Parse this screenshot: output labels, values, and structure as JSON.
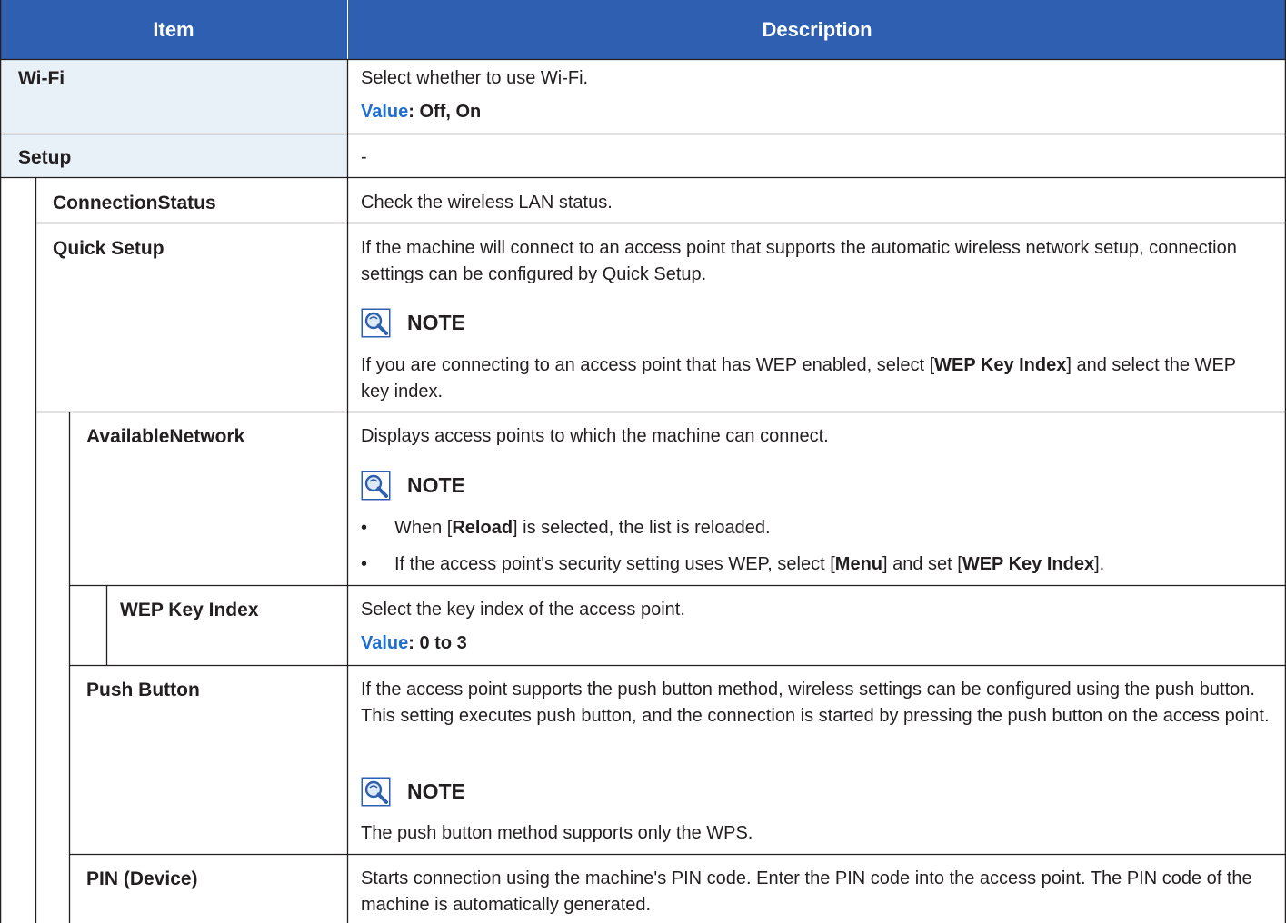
{
  "header": {
    "item": "Item",
    "description": "Description"
  },
  "rows": {
    "wifi": {
      "label": "Wi-Fi",
      "desc": "Select whether to use Wi-Fi.",
      "value_label": "Value",
      "value_text": ": Off, On"
    },
    "setup": {
      "label": "Setup",
      "desc": "-"
    },
    "connection_status": {
      "label": "ConnectionStatus",
      "desc": "Check the wireless LAN status."
    },
    "quick_setup": {
      "label": "Quick Setup",
      "desc": "If the machine will connect to an access point that supports the automatic wireless network setup, connection settings can be configured by Quick Setup.",
      "note_title": "NOTE",
      "note_pre": "If you are connecting to an access point that has WEP enabled, select [",
      "note_bold": "WEP Key Index",
      "note_post": "] and select the WEP key index."
    },
    "available_network": {
      "label": "AvailableNetwork",
      "desc": "Displays access points to which the machine can connect.",
      "note_title": "NOTE",
      "bullet_symbol": "•",
      "b1_pre": "When [",
      "b1_bold": "Reload",
      "b1_post": "] is selected, the list is reloaded.",
      "b2_pre": "If the access point's security setting uses WEP, select [",
      "b2_bold1": "Menu",
      "b2_mid": "] and set [",
      "b2_bold2": "WEP Key Index",
      "b2_post": "]."
    },
    "wep_key_index": {
      "label": "WEP Key Index",
      "desc": "Select the key index of the access point.",
      "value_label": "Value",
      "value_text": ": 0 to 3"
    },
    "push_button": {
      "label": "Push Button",
      "desc": "If the access point supports the push button method, wireless settings can be configured using the push button. This setting executes push button, and the connection is started by pressing the push button on the access point.",
      "note_title": "NOTE",
      "note_text": "The push button method supports only the WPS."
    },
    "pin_device": {
      "label": "PIN (Device)",
      "desc": "Starts connection using the machine's PIN code. Enter the PIN code into the access point. The PIN code of the machine is automatically generated."
    }
  },
  "colors": {
    "header_bg": "#2f5fb1",
    "item_shade": "#e8f0f8",
    "value_label": "#1f6ed6",
    "border": "#231f20"
  },
  "icons": {
    "note": "note-magnifier-icon"
  }
}
